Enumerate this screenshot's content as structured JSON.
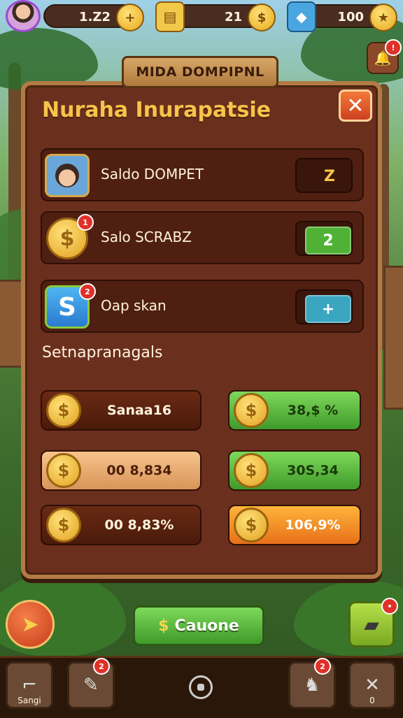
{
  "topbar": {
    "resources": [
      {
        "value": "1.Z2",
        "cap_icon": "plus-icon",
        "cap_glyph": "+"
      },
      {
        "value": "21",
        "cap_icon": "dollar-coin-icon",
        "cap_glyph": "$"
      },
      {
        "value": "100",
        "cap_icon": "star-icon",
        "cap_glyph": "★"
      }
    ]
  },
  "panel": {
    "ribbon": "MIDA DOMPIPNL",
    "title": "Nuraha Inurapatsie",
    "close_glyph": "✕",
    "rows": [
      {
        "label": "Saldo DOMPET",
        "value": "Z",
        "value_color": "#3a160a",
        "text_color": "#f6c44a",
        "badge": ""
      },
      {
        "label": "Salo SCRABZ",
        "value": "2",
        "value_color": "#4fb236",
        "text_color": "#fff",
        "badge": "1"
      },
      {
        "label": "Oap skan",
        "value": "+",
        "value_color": "#3aa6c0",
        "text_color": "#fff",
        "badge": "2"
      }
    ],
    "section_title": "Setnapranagals",
    "grid": [
      [
        {
          "text": "Sanaa16",
          "style": "brown"
        },
        {
          "text": "38,$ %",
          "style": "green"
        }
      ],
      [
        {
          "text": "00 8,834",
          "style": "tan"
        },
        {
          "text": "30S,34",
          "style": "green"
        }
      ],
      [
        {
          "text": "00 8,83%",
          "style": "brown"
        },
        {
          "text": "106,9%",
          "style": "orange"
        }
      ]
    ]
  },
  "cta_label": "Cauone",
  "cta_glyph": "$",
  "bottom_nav": [
    {
      "label": "Sangi",
      "icon": "boot-icon",
      "glyph": "⌐",
      "badge": ""
    },
    {
      "label": "",
      "icon": "paint-tube-icon",
      "glyph": "✎",
      "badge": "2"
    },
    {
      "label": "",
      "icon": "pet-icon",
      "glyph": "♞",
      "badge": "2"
    },
    {
      "label": "0",
      "icon": "tools-icon",
      "glyph": "✕",
      "badge": ""
    }
  ],
  "colors": {
    "accent": "#f6c44a",
    "panel": "#6b2f1e",
    "green": "#4fb236",
    "orange": "#f08a1c"
  }
}
